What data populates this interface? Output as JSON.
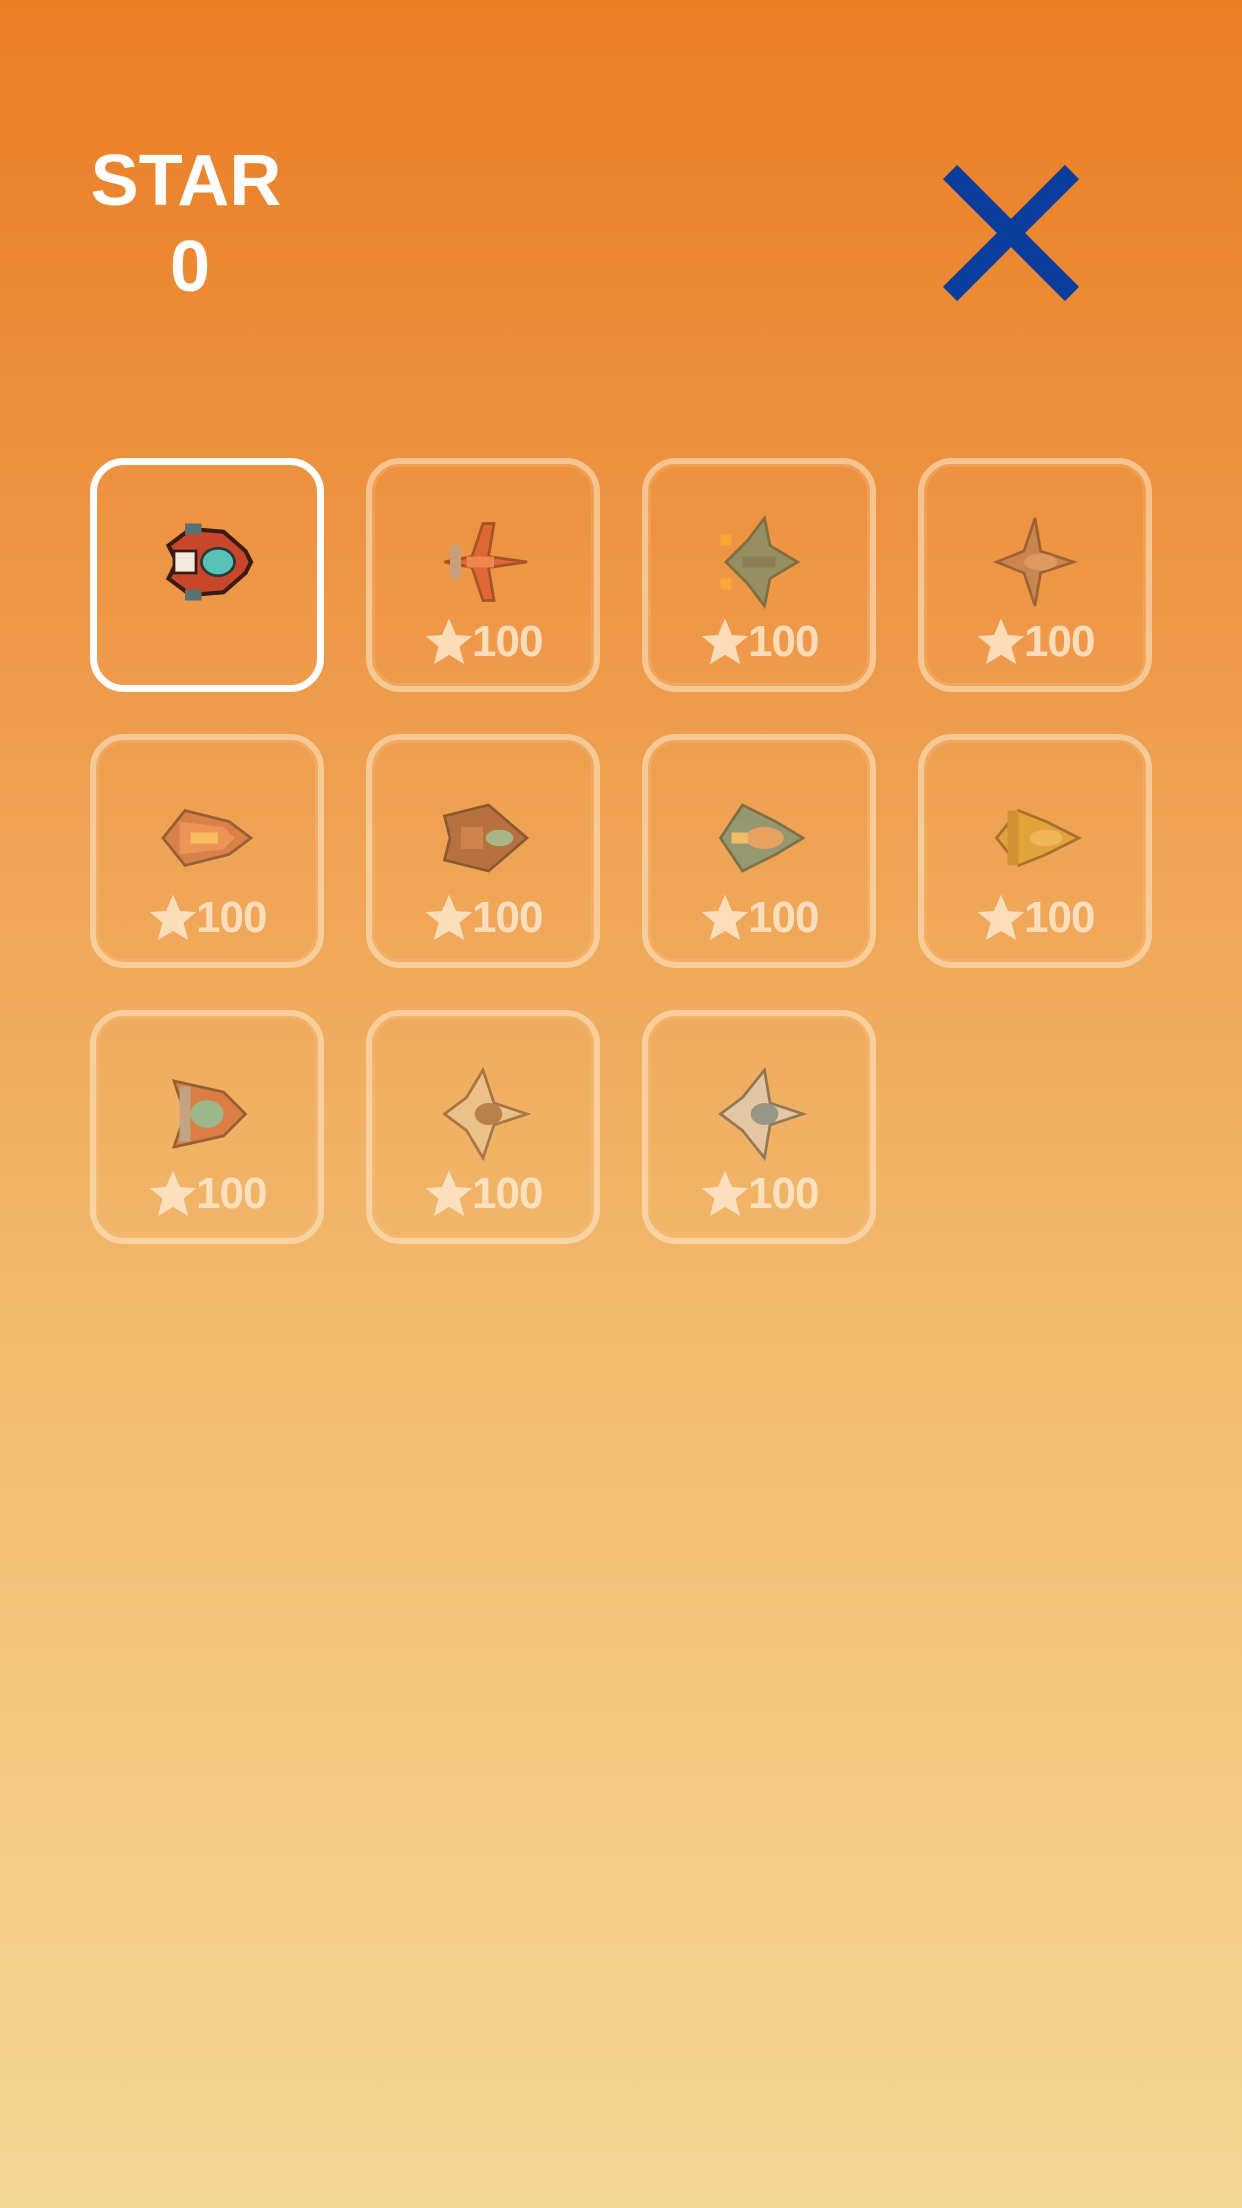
{
  "hud": {
    "star_label": "STAR",
    "star_value": "0"
  },
  "close_icon": "close-icon",
  "colors": {
    "close": "#0a3d9a",
    "selected_border": "#ffffff"
  },
  "ships": [
    {
      "name": "ship-1",
      "state": "selected",
      "price": ""
    },
    {
      "name": "ship-2",
      "state": "locked",
      "price": "100"
    },
    {
      "name": "ship-3",
      "state": "locked",
      "price": "100"
    },
    {
      "name": "ship-4",
      "state": "locked",
      "price": "100"
    },
    {
      "name": "ship-5",
      "state": "locked",
      "price": "100"
    },
    {
      "name": "ship-6",
      "state": "locked",
      "price": "100"
    },
    {
      "name": "ship-7",
      "state": "locked",
      "price": "100"
    },
    {
      "name": "ship-8",
      "state": "locked",
      "price": "100"
    },
    {
      "name": "ship-9",
      "state": "locked",
      "price": "100"
    },
    {
      "name": "ship-10",
      "state": "locked",
      "price": "100"
    },
    {
      "name": "ship-11",
      "state": "locked",
      "price": "100"
    }
  ]
}
